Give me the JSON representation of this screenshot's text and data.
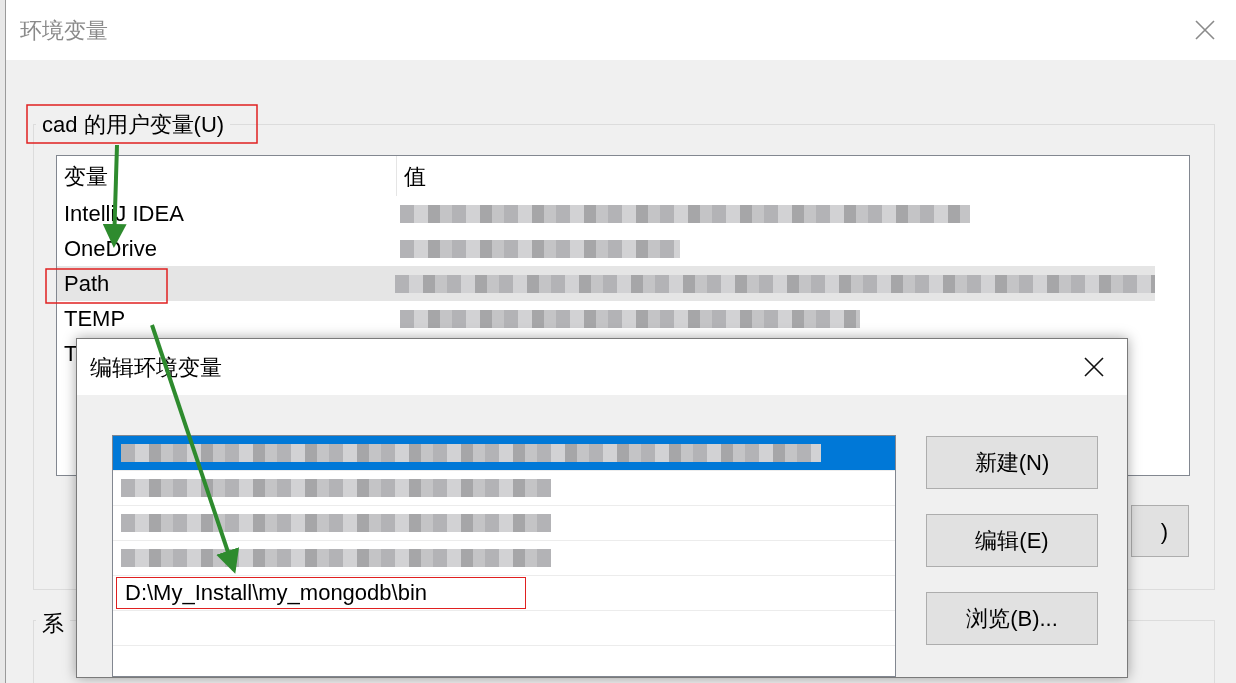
{
  "window": {
    "title": "环境变量"
  },
  "user_variables": {
    "label": "cad 的用户变量(U)",
    "columns": [
      "变量",
      "值"
    ],
    "rows": [
      {
        "name": "IntelliJ IDEA",
        "value_redacted": true,
        "selected": false
      },
      {
        "name": "OneDrive",
        "value_redacted": true,
        "selected": false
      },
      {
        "name": "Path",
        "value_redacted": true,
        "selected": true
      },
      {
        "name": "TEMP",
        "value_redacted": true,
        "selected": false
      },
      {
        "name": "T",
        "selected": false
      }
    ],
    "button_partial": ")"
  },
  "system_variables": {
    "label": "系"
  },
  "edit_dialog": {
    "title": "编辑环境变量",
    "items": [
      {
        "kind": "blurred",
        "selected": true
      },
      {
        "kind": "blurred",
        "selected": false
      },
      {
        "kind": "blurred",
        "selected": false
      },
      {
        "kind": "blurred",
        "selected": false
      },
      {
        "kind": "text",
        "text": "D:\\My_Install\\my_mongodb\\bin",
        "selected": false
      }
    ],
    "buttons": [
      "新建(N)",
      "编辑(E)",
      "浏览(B)..."
    ]
  }
}
